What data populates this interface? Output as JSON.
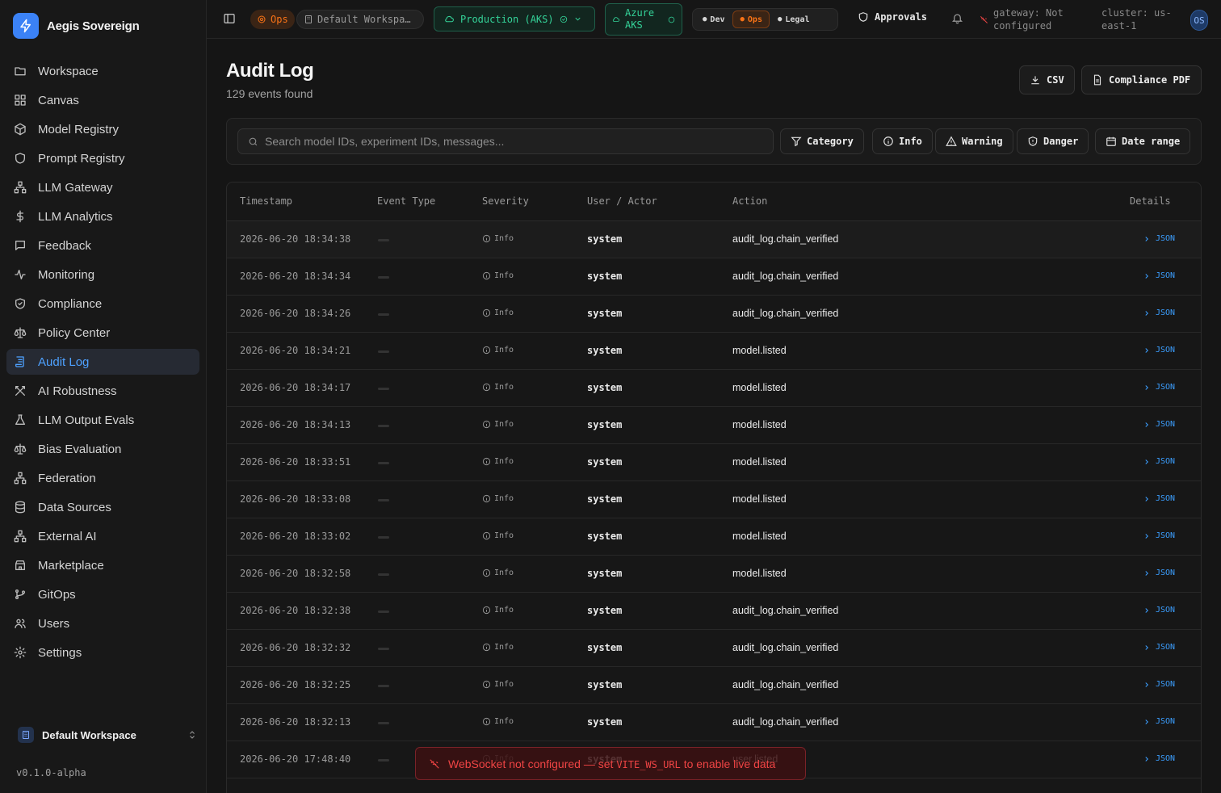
{
  "app": {
    "name": "Aegis Sovereign",
    "version": "v0.1.0-alpha"
  },
  "sidebar": {
    "items": [
      {
        "label": "Workspace",
        "icon": "folder-icon"
      },
      {
        "label": "Canvas",
        "icon": "grid-icon"
      },
      {
        "label": "Model Registry",
        "icon": "cube-icon"
      },
      {
        "label": "Prompt Registry",
        "icon": "shield-icon"
      },
      {
        "label": "LLM Gateway",
        "icon": "network-icon"
      },
      {
        "label": "LLM Analytics",
        "icon": "dollar-icon"
      },
      {
        "label": "Feedback",
        "icon": "message-icon"
      },
      {
        "label": "Monitoring",
        "icon": "activity-icon"
      },
      {
        "label": "Compliance",
        "icon": "shield-check-icon"
      },
      {
        "label": "Policy Center",
        "icon": "scale-icon"
      },
      {
        "label": "Audit Log",
        "icon": "scroll-icon",
        "active": true
      },
      {
        "label": "AI Robustness",
        "icon": "swords-icon"
      },
      {
        "label": "LLM Output Evals",
        "icon": "flask-icon"
      },
      {
        "label": "Bias Evaluation",
        "icon": "scale-icon"
      },
      {
        "label": "Federation",
        "icon": "network-icon"
      },
      {
        "label": "Data Sources",
        "icon": "database-icon"
      },
      {
        "label": "External AI",
        "icon": "network-icon"
      },
      {
        "label": "Marketplace",
        "icon": "store-icon"
      },
      {
        "label": "GitOps",
        "icon": "git-branch-icon"
      },
      {
        "label": "Users",
        "icon": "users-icon"
      },
      {
        "label": "Settings",
        "icon": "gear-icon"
      }
    ],
    "workspace": "Default Workspace"
  },
  "topbar": {
    "ops_badge": "Ops",
    "workspace": "Default Workspa…",
    "environment": "Production (AKS)",
    "cloud_line1": "Azure",
    "cloud_line2": "AKS",
    "roles": [
      {
        "label": "Dev"
      },
      {
        "label": "Ops",
        "active": true
      },
      {
        "label": "Legal"
      }
    ],
    "approvals": "Approvals",
    "gateway_line1": "gateway: Not",
    "gateway_line2": "configured",
    "cluster_line1": "cluster: us-",
    "cluster_line2": "east-1",
    "avatar": "OS"
  },
  "page": {
    "title": "Audit Log",
    "subtitle": "129 events found",
    "csv_label": "CSV",
    "pdf_label": "Compliance PDF"
  },
  "filters": {
    "search_placeholder": "Search model IDs, experiment IDs, messages...",
    "category": "Category",
    "info": "Info",
    "warning": "Warning",
    "danger": "Danger",
    "date_range": "Date range"
  },
  "table": {
    "headers": {
      "timestamp": "Timestamp",
      "event_type": "Event Type",
      "severity": "Severity",
      "user": "User / Actor",
      "action": "Action",
      "details": "Details"
    },
    "rows": [
      {
        "ts": "2026-06-20 18:34:38",
        "sev": "Info",
        "user": "system",
        "action": "audit_log.chain_verified",
        "details": "JSON"
      },
      {
        "ts": "2026-06-20 18:34:34",
        "sev": "Info",
        "user": "system",
        "action": "audit_log.chain_verified",
        "details": "JSON"
      },
      {
        "ts": "2026-06-20 18:34:26",
        "sev": "Info",
        "user": "system",
        "action": "audit_log.chain_verified",
        "details": "JSON"
      },
      {
        "ts": "2026-06-20 18:34:21",
        "sev": "Info",
        "user": "system",
        "action": "model.listed",
        "details": "JSON"
      },
      {
        "ts": "2026-06-20 18:34:17",
        "sev": "Info",
        "user": "system",
        "action": "model.listed",
        "details": "JSON"
      },
      {
        "ts": "2026-06-20 18:34:13",
        "sev": "Info",
        "user": "system",
        "action": "model.listed",
        "details": "JSON"
      },
      {
        "ts": "2026-06-20 18:33:51",
        "sev": "Info",
        "user": "system",
        "action": "model.listed",
        "details": "JSON"
      },
      {
        "ts": "2026-06-20 18:33:08",
        "sev": "Info",
        "user": "system",
        "action": "model.listed",
        "details": "JSON"
      },
      {
        "ts": "2026-06-20 18:33:02",
        "sev": "Info",
        "user": "system",
        "action": "model.listed",
        "details": "JSON"
      },
      {
        "ts": "2026-06-20 18:32:58",
        "sev": "Info",
        "user": "system",
        "action": "model.listed",
        "details": "JSON"
      },
      {
        "ts": "2026-06-20 18:32:38",
        "sev": "Info",
        "user": "system",
        "action": "audit_log.chain_verified",
        "details": "JSON"
      },
      {
        "ts": "2026-06-20 18:32:32",
        "sev": "Info",
        "user": "system",
        "action": "audit_log.chain_verified",
        "details": "JSON"
      },
      {
        "ts": "2026-06-20 18:32:25",
        "sev": "Info",
        "user": "system",
        "action": "audit_log.chain_verified",
        "details": "JSON"
      },
      {
        "ts": "2026-06-20 18:32:13",
        "sev": "Info",
        "user": "system",
        "action": "audit_log.chain_verified",
        "details": "JSON"
      },
      {
        "ts": "2026-06-20 17:48:40",
        "sev": "Info",
        "user": "system",
        "action": "user.listed",
        "details": "JSON"
      }
    ]
  },
  "toast": {
    "prefix": "WebSocket not configured — set",
    "code": "VITE_WS_URL",
    "suffix": "to enable live data"
  }
}
